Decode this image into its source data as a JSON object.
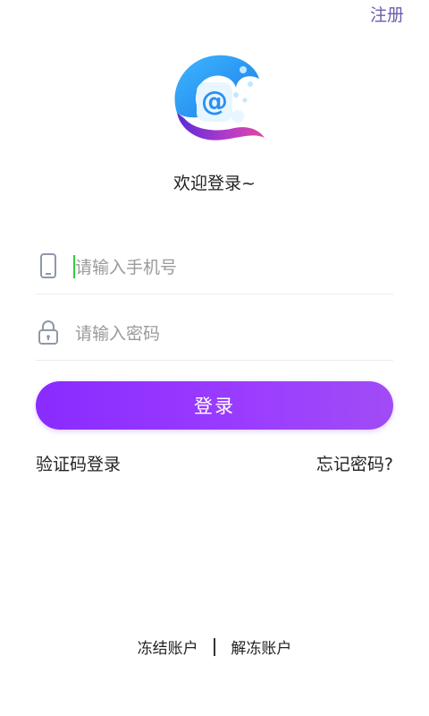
{
  "header": {
    "register_label": "注册"
  },
  "welcome_text": "欢迎登录~",
  "form": {
    "phone_placeholder": "请输入手机号",
    "password_placeholder": "请输入密码",
    "login_label": "登录"
  },
  "links": {
    "sms_login": "验证码登录",
    "forgot_password": "忘记密码?"
  },
  "footer": {
    "freeze_account": "冻结账户",
    "unfreeze_account": "解冻账户"
  },
  "icons": {
    "logo": "at-sign-logo",
    "phone": "phone-icon",
    "password": "lock-icon"
  },
  "colors": {
    "accent": "#8a2bff",
    "register_link": "#6f5bb0",
    "caret": "#2fcf3a"
  }
}
